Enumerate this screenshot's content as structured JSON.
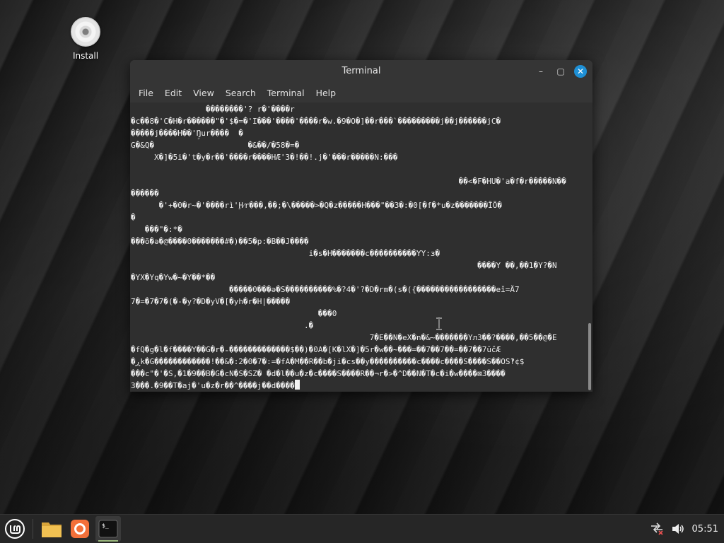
{
  "desktop": {
    "icons": [
      {
        "label": "Install",
        "icon": "disc-icon"
      }
    ]
  },
  "window": {
    "title": "Terminal",
    "controls": {
      "minimize": "–",
      "maximize": "▢",
      "close": "✕"
    },
    "menu": [
      "File",
      "Edit",
      "View",
      "Search",
      "Terminal",
      "Help"
    ]
  },
  "terminal": {
    "lines": [
      "                ��������'? r�'����r",
      "�c��8�'C�H�r������\"�'$�=�'I���'����'����r�w.�9�O�]��r���`���������j��j������jC�",
      "�����j����H��'Ŋ̧ur����  �",
      "G�&Q�                    �&��/�58�=�",
      "     X�]�5i�'t�y�r��'����r����HÆ'3�!��!.j�'���r�����N:���",
      "",
      "                                                                      ��<�F�HU�'a�f�r�����N��",
      "������",
      "      �'+�0�r~�'����rì'Ḩ⁄r���,��;�\\�����>�Q�z�����H���\"��3�:�0[�f�*u�z�������ĨÕ�",
      "�",
      "   ���\"�:*�",
      "���õ�ə�@����0�������#�)��5�p:�B��J����",
      "                                      i�s�H�������c����������YY:ɜ�",
      "                                                                          ����Y ��,��1�Y?�N",
      "�YX�Yq�Yw�~�Y��*��",
      "                     �����0���ə�S����������%�?4�'?�D�rm�(s�({�����������������eǐ=Ä7",
      "7�=�7�7�(�-�y?�D�yV�[�yh�r�H|�����",
      "                                        ���0",
      "                                     .�",
      "                                                   7�E��N�eX�n�&~�������Υл3��?����,��5��@�E",
      "�fQ�g�l�f����Y��G�r�₌�������������$��)�0A�[K�lX�]�5r�w��~���=��7��7��=��7��7ŭčÆ",
      "�ڕk�G������������!��&�:2�0�7�:=�fA�M��R��b�ji�cs��y����������c����c����S����S��OS‽¢$",
      "���c\"�'�S,�1�9��B�G�cN�S�SZ� �d�l��u�z�c����S����R��¬r�>�^D��N�T�c�i�w����⊠3����",
      "3���.�9��T�aj�'u�z�r��^����j��d����"
    ]
  },
  "taskbar": {
    "menu_icon": "mint-menu-icon",
    "apps": [
      {
        "name": "files-icon",
        "active": false
      },
      {
        "name": "firefox-icon",
        "active": false
      },
      {
        "name": "terminal-icon",
        "active": true,
        "glyph": "$_"
      }
    ],
    "tray": {
      "network_icon": "network-disconnected-icon",
      "volume_icon": "volume-icon",
      "clock": "05:51"
    }
  }
}
